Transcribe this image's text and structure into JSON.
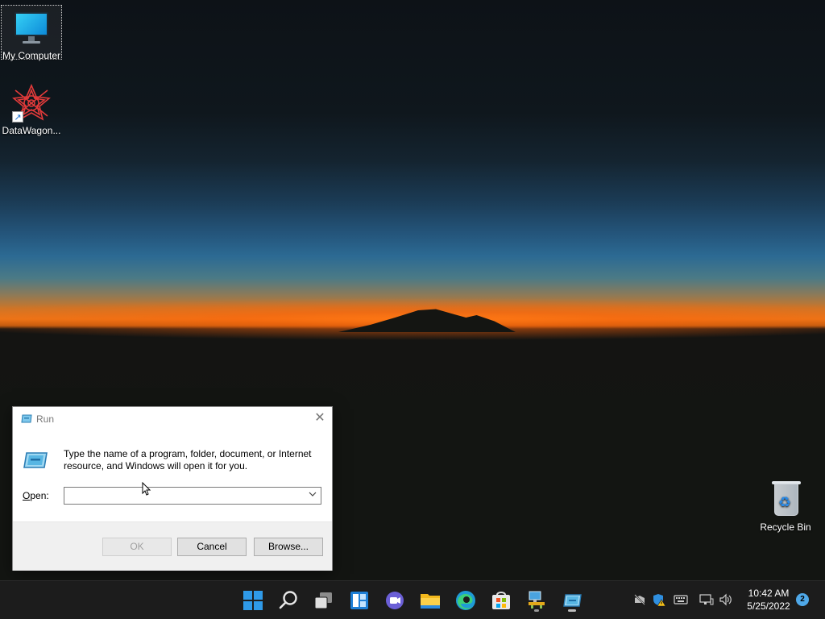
{
  "desktop": {
    "icons": [
      {
        "label": "My Computer",
        "icon": "monitor-icon"
      },
      {
        "label": "DataWagon...",
        "icon": "datawagon-icon"
      },
      {
        "label": "Recycle Bin",
        "icon": "recycle-bin-icon"
      }
    ]
  },
  "run_dialog": {
    "title": "Run",
    "description": "Type the name of a program, folder, document, or Internet resource, and Windows will open it for you.",
    "open_label": "Open:",
    "open_value": "",
    "ok_label": "OK",
    "cancel_label": "Cancel",
    "browse_label": "Browse..."
  },
  "taskbar": {
    "apps": [
      {
        "name": "start-icon"
      },
      {
        "name": "search-icon"
      },
      {
        "name": "task-view-icon"
      },
      {
        "name": "widgets-icon"
      },
      {
        "name": "chat-icon"
      },
      {
        "name": "file-explorer-icon"
      },
      {
        "name": "edge-icon"
      },
      {
        "name": "store-icon"
      },
      {
        "name": "network-manager-icon",
        "running": true
      },
      {
        "name": "run-icon",
        "running": true
      }
    ],
    "tray": {
      "icons": [
        "network-disconnected-icon",
        "security-warning-icon",
        "keyboard-icon",
        "display-icon",
        "volume-icon"
      ],
      "time": "10:42 AM",
      "date": "5/25/2022",
      "notification_count": "2"
    }
  },
  "colors": {
    "accent": "#0078d4",
    "taskbar": "#1c1c1c",
    "sunset": "#e8781a"
  }
}
